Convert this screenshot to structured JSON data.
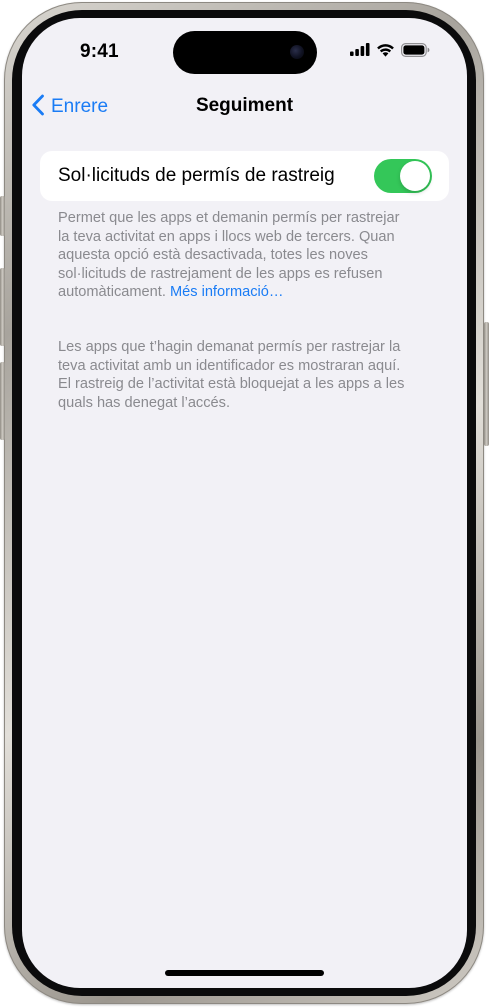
{
  "status_bar": {
    "time": "9:41",
    "icons": [
      "cellular-signal-icon",
      "wifi-icon",
      "battery-icon"
    ]
  },
  "nav": {
    "back_label": "Enrere",
    "title": "Seguiment"
  },
  "tracking_setting": {
    "label": "Sol·licituds de permís de rastreig",
    "toggle_on": true
  },
  "footnotes": {
    "description_lines": [
      "Permet que les apps et demanin permís per rastrejar",
      "la teva activitat en apps i llocs web de tercers. Quan",
      "aquesta opció està desactivada, totes les noves",
      "sol·licituds de rastrejament de les apps es refusen"
    ],
    "description_last": "automàticament.",
    "more_link": "Més informació…",
    "apps_info_lines": [
      "Les apps que t’hagin demanat permís per rastrejar la",
      "teva activitat amb un identificador es mostraran aquí.",
      "El rastreig de l’activitat està bloquejat a les apps a les",
      "quals has denegat l’accés."
    ]
  },
  "colors": {
    "accent": "#1a7cf5",
    "toggle_on": "#34c759",
    "background": "#f2f1f6",
    "footnote_text": "#8a8a8f"
  }
}
